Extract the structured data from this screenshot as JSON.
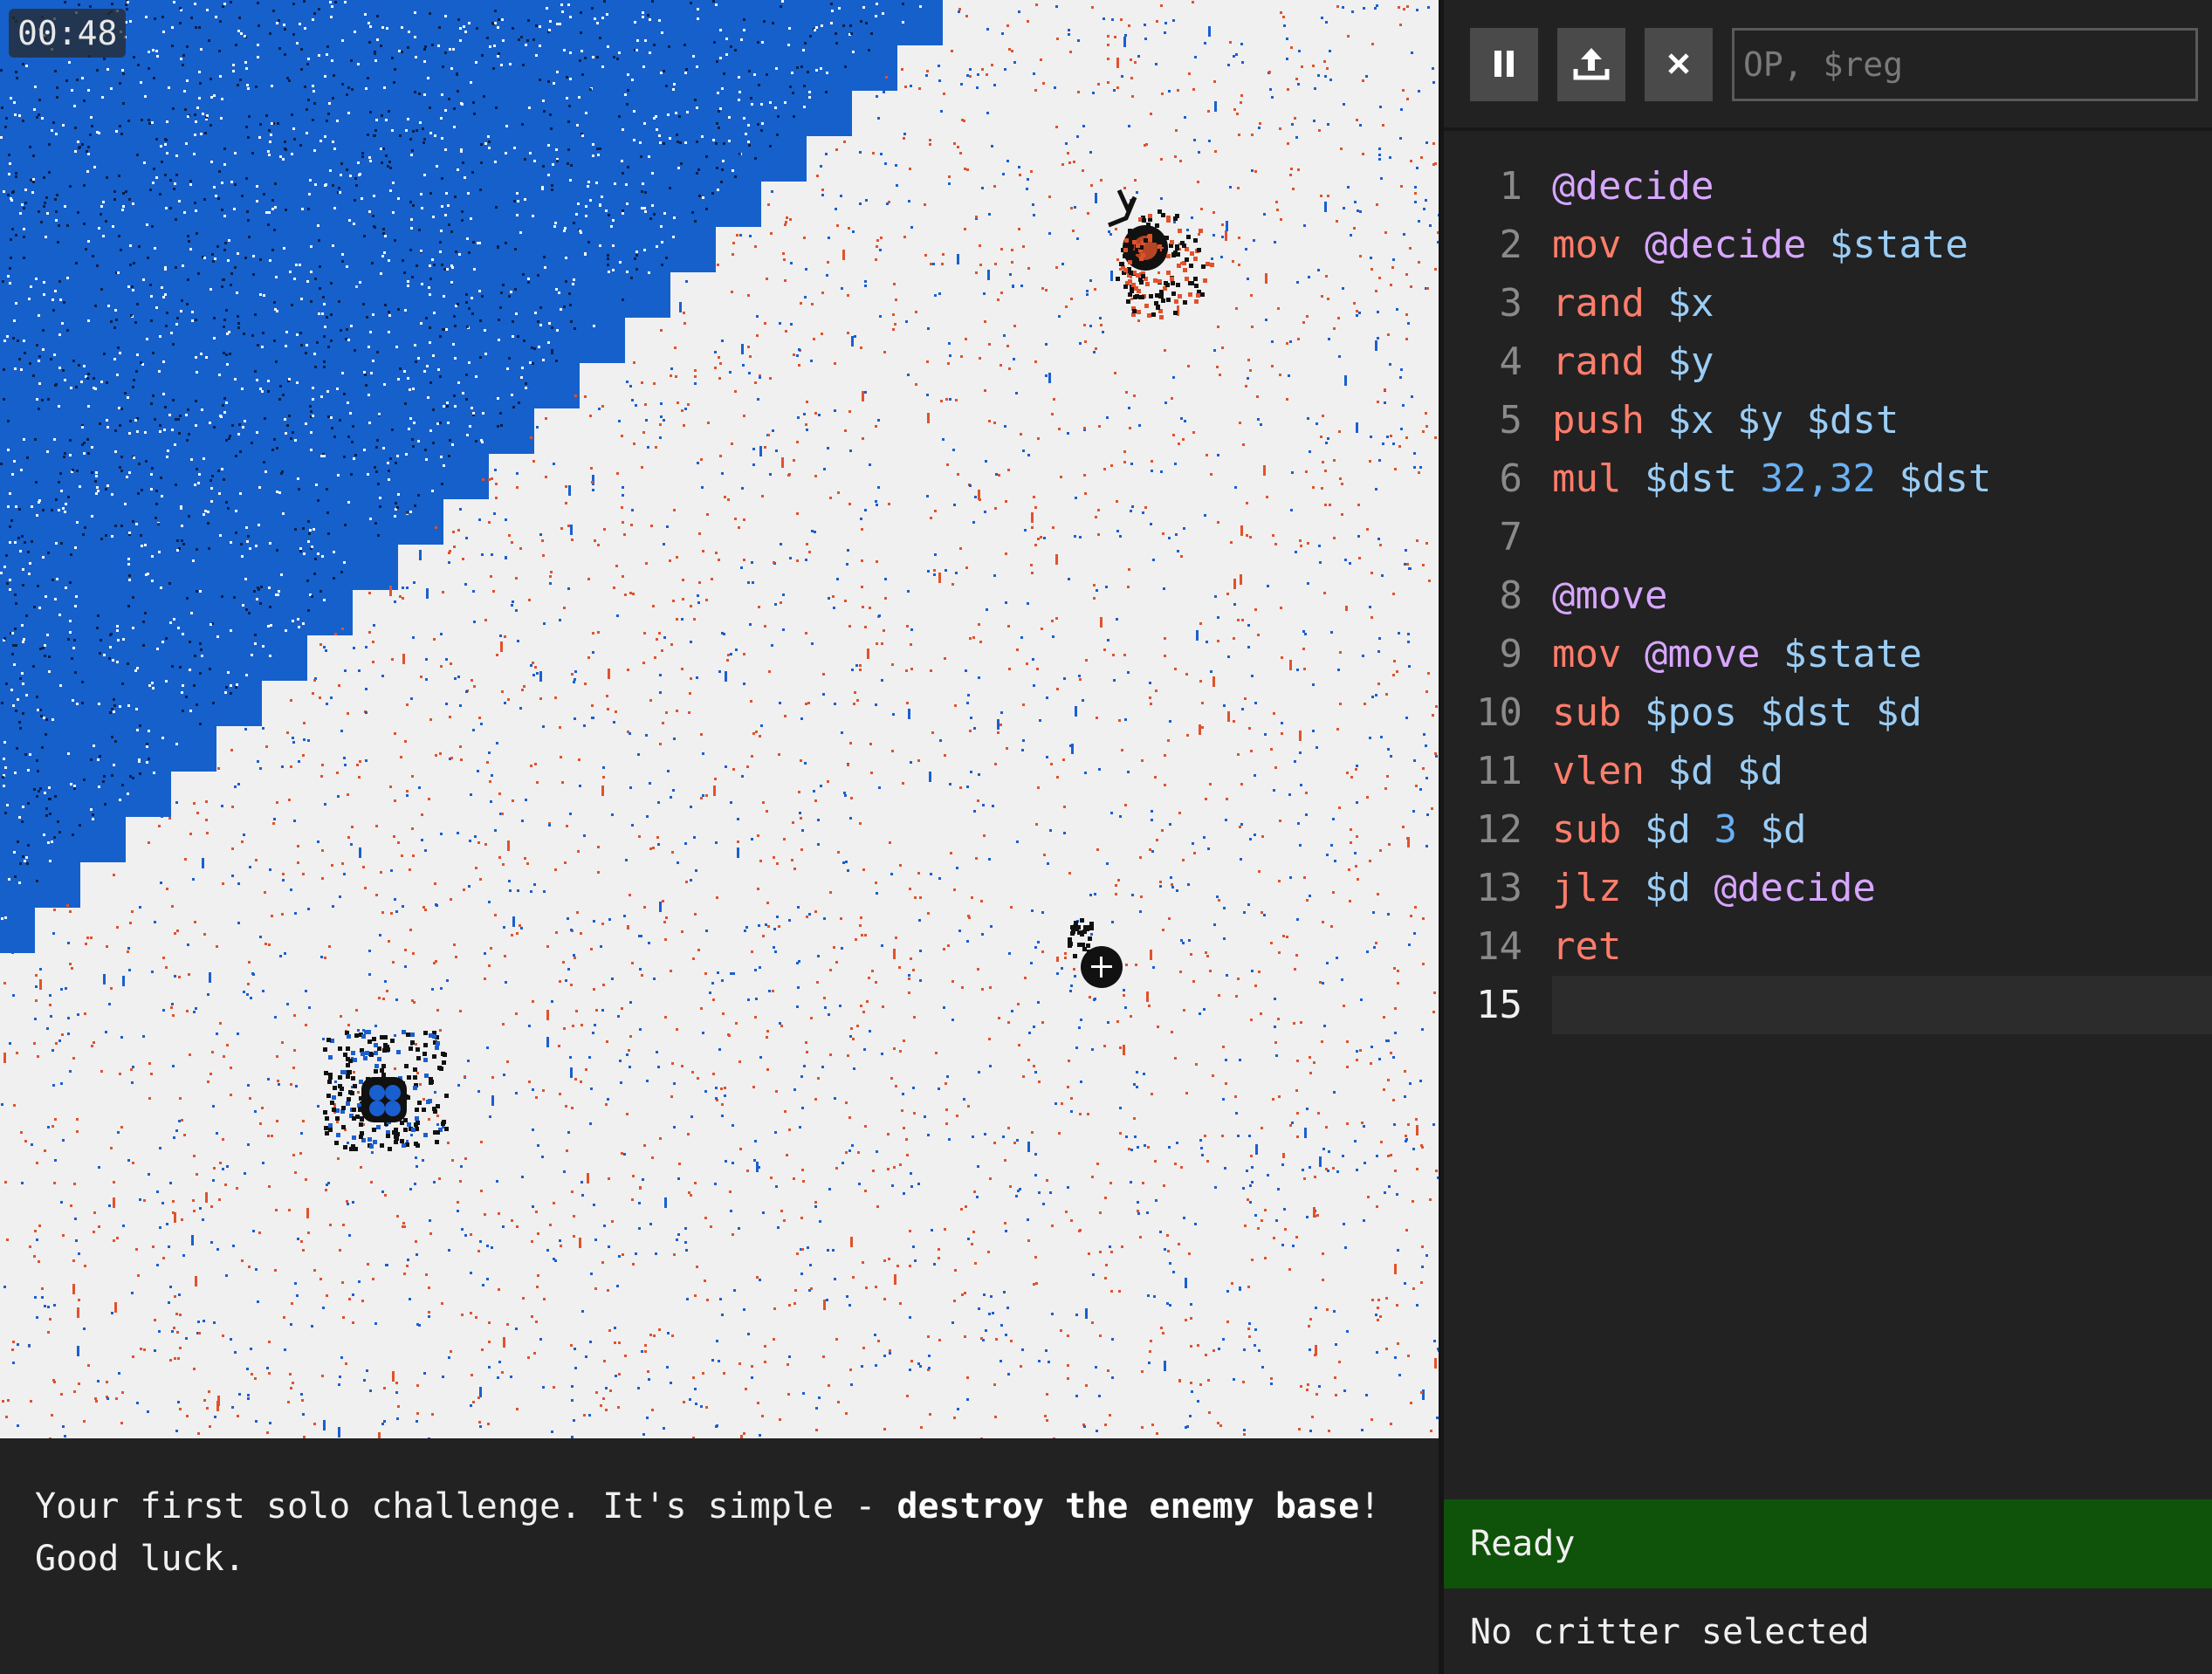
{
  "game": {
    "timer": "00:48",
    "colors": {
      "ground": "#f0f0f0",
      "water": "#1660cc",
      "blue_team": "#1a5fd0",
      "red_team": "#e0522c",
      "critter_dark": "#111111"
    },
    "entities": [
      "player-base",
      "enemy-base",
      "critter"
    ]
  },
  "toolbar": {
    "pause_icon": "pause-icon",
    "upload_icon": "upload-icon",
    "close_icon": "close-icon",
    "input_placeholder": "OP, $reg"
  },
  "editor": {
    "current_line": "15",
    "lines": [
      {
        "num": "1",
        "tokens": [
          {
            "t": "label",
            "v": "@decide"
          }
        ]
      },
      {
        "num": "2",
        "tokens": [
          {
            "t": "op",
            "v": "mov"
          },
          {
            "t": "label",
            "v": "@decide"
          },
          {
            "t": "reg",
            "v": "$state"
          }
        ]
      },
      {
        "num": "3",
        "tokens": [
          {
            "t": "op",
            "v": "rand"
          },
          {
            "t": "reg",
            "v": "$x"
          }
        ]
      },
      {
        "num": "4",
        "tokens": [
          {
            "t": "op",
            "v": "rand"
          },
          {
            "t": "reg",
            "v": "$y"
          }
        ]
      },
      {
        "num": "5",
        "tokens": [
          {
            "t": "op",
            "v": "push"
          },
          {
            "t": "reg",
            "v": "$x"
          },
          {
            "t": "reg",
            "v": "$y"
          },
          {
            "t": "reg",
            "v": "$dst"
          }
        ]
      },
      {
        "num": "6",
        "tokens": [
          {
            "t": "op",
            "v": "mul"
          },
          {
            "t": "reg",
            "v": "$dst"
          },
          {
            "t": "num",
            "v": "32,32"
          },
          {
            "t": "reg",
            "v": "$dst"
          }
        ]
      },
      {
        "num": "7",
        "tokens": []
      },
      {
        "num": "8",
        "tokens": [
          {
            "t": "label",
            "v": "@move"
          }
        ]
      },
      {
        "num": "9",
        "tokens": [
          {
            "t": "op",
            "v": "mov"
          },
          {
            "t": "label",
            "v": "@move"
          },
          {
            "t": "reg",
            "v": "$state"
          }
        ]
      },
      {
        "num": "10",
        "tokens": [
          {
            "t": "op",
            "v": "sub"
          },
          {
            "t": "reg",
            "v": "$pos"
          },
          {
            "t": "reg",
            "v": "$dst"
          },
          {
            "t": "reg",
            "v": "$d"
          }
        ]
      },
      {
        "num": "11",
        "tokens": [
          {
            "t": "op",
            "v": "vlen"
          },
          {
            "t": "reg",
            "v": "$d"
          },
          {
            "t": "reg",
            "v": "$d"
          }
        ]
      },
      {
        "num": "12",
        "tokens": [
          {
            "t": "op",
            "v": "sub"
          },
          {
            "t": "reg",
            "v": "$d"
          },
          {
            "t": "num",
            "v": "3"
          },
          {
            "t": "reg",
            "v": "$d"
          }
        ]
      },
      {
        "num": "13",
        "tokens": [
          {
            "t": "op",
            "v": "jlz"
          },
          {
            "t": "reg",
            "v": "$d"
          },
          {
            "t": "label",
            "v": "@decide"
          }
        ]
      },
      {
        "num": "14",
        "tokens": [
          {
            "t": "op",
            "v": "ret"
          }
        ]
      },
      {
        "num": "15",
        "tokens": []
      }
    ]
  },
  "status": {
    "text": "Ready",
    "color": "#0f5209"
  },
  "selection": {
    "text": "No critter selected"
  },
  "message": {
    "part1": "Your first solo challenge. It's simple - ",
    "bold": "destroy the enemy base",
    "part2": "!",
    "line2": "Good luck."
  }
}
